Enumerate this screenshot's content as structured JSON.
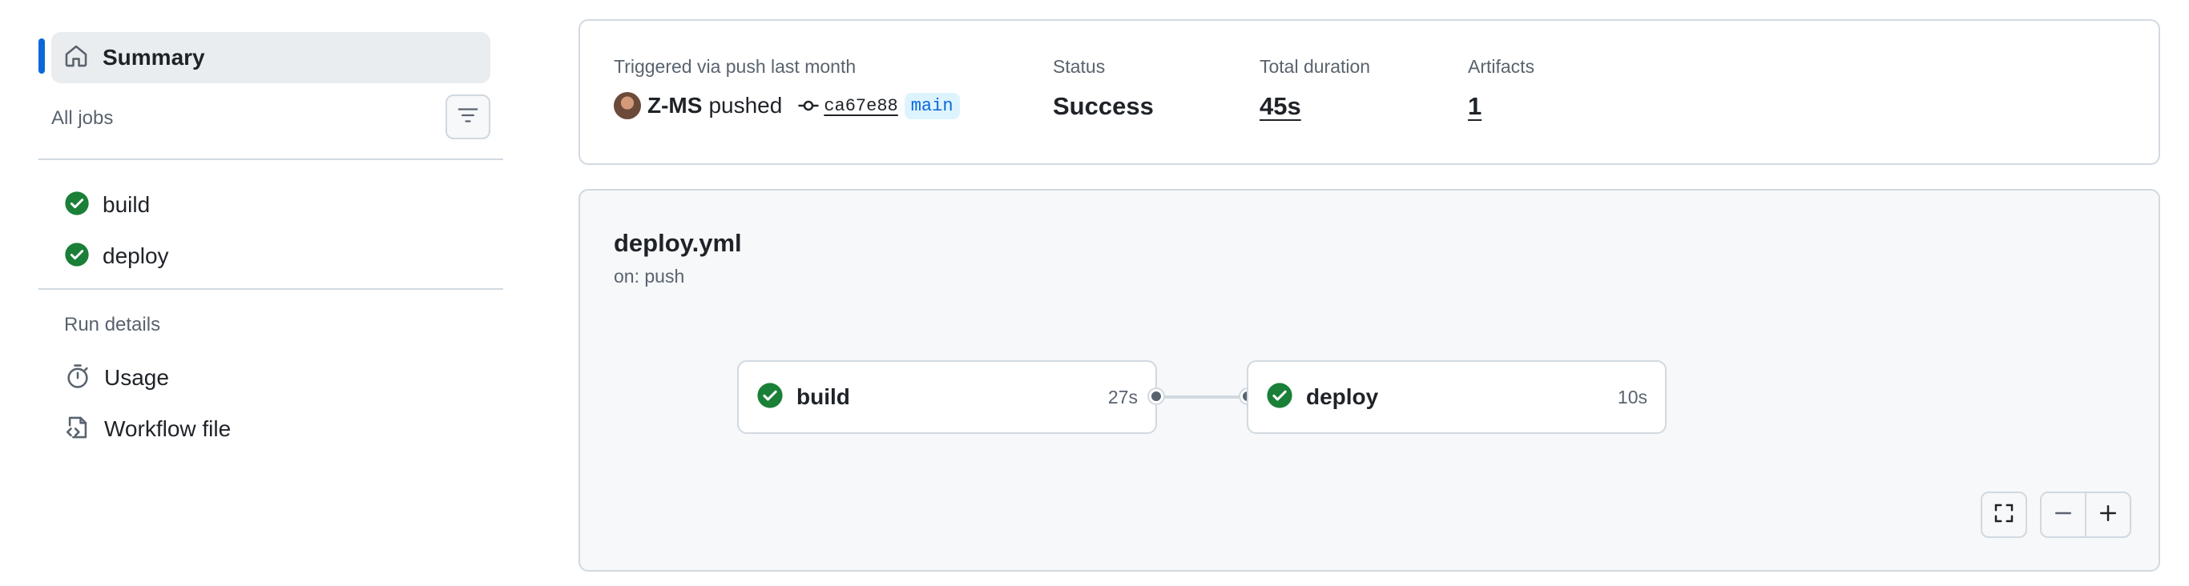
{
  "sidebar": {
    "summary_label": "Summary",
    "all_jobs_label": "All jobs",
    "jobs": [
      {
        "label": "build",
        "status": "success"
      },
      {
        "label": "deploy",
        "status": "success"
      }
    ],
    "run_details_heading": "Run details",
    "details": [
      {
        "label": "Usage",
        "icon": "stopwatch-icon"
      },
      {
        "label": "Workflow file",
        "icon": "file-code-icon"
      }
    ]
  },
  "summary": {
    "trigger_label": "Triggered via push last month",
    "actor": "Z-MS",
    "action": "pushed",
    "commit_sha": "ca67e88",
    "branch": "main",
    "status_label": "Status",
    "status_value": "Success",
    "duration_label": "Total duration",
    "duration_value": "45s",
    "artifacts_label": "Artifacts",
    "artifacts_value": "1"
  },
  "workflow": {
    "name": "deploy.yml",
    "trigger": "on: push",
    "jobs": [
      {
        "name": "build",
        "duration": "27s",
        "status": "success"
      },
      {
        "name": "deploy",
        "duration": "10s",
        "status": "success"
      }
    ]
  },
  "colors": {
    "accent": "#0969da",
    "success": "#1a7f37",
    "muted": "#59636e",
    "border": "#d1d9e0"
  }
}
